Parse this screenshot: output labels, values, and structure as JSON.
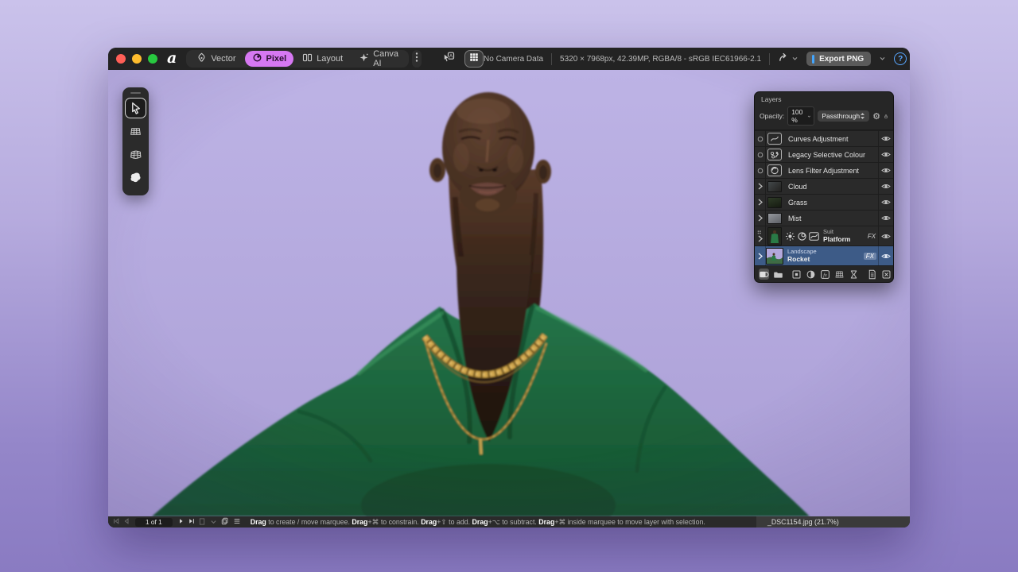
{
  "titlebar": {
    "personas": {
      "vector": "Vector",
      "pixel": "Pixel",
      "layout": "Layout",
      "canva_ai": "Canva AI"
    },
    "camera_status": "No Camera Data",
    "document_info": "5320 × 7968px, 42.39MP, RGBA/8 - sRGB IEC61966-2.1",
    "export_label": "Export PNG",
    "help_label": "?"
  },
  "layers": {
    "panel_title": "Layers",
    "opacity_label": "Opacity:",
    "opacity_value": "100 %",
    "blend_mode": "Passthrough",
    "rows": [
      {
        "name": "Curves Adjustment"
      },
      {
        "name": "Legacy Selective Colour"
      },
      {
        "name": "Lens Filter Adjustment"
      },
      {
        "name": "Cloud"
      },
      {
        "name": "Grass"
      },
      {
        "name": "Mist"
      },
      {
        "tag": "Suit",
        "name": "Platform",
        "fx": "FX"
      },
      {
        "tag": "Landscape",
        "name": "Rocket",
        "fx": "FX",
        "selected": true
      }
    ]
  },
  "statusbar": {
    "page_indicator": "1 of 1",
    "file_info": "_DSC1154.jpg (21.7%)",
    "hint_segments": [
      {
        "text": "Drag",
        "bold": true
      },
      {
        "text": " to create / move marquee. ",
        "bold": false
      },
      {
        "text": "Drag",
        "bold": true
      },
      {
        "text": "+⌘ to constrain. ",
        "bold": false
      },
      {
        "text": "Drag",
        "bold": true
      },
      {
        "text": "+⇧ to add. ",
        "bold": false
      },
      {
        "text": "Drag",
        "bold": true
      },
      {
        "text": "+⌥ to subtract. ",
        "bold": false
      },
      {
        "text": "Drag",
        "bold": true
      },
      {
        "text": "+⌘ inside marquee to move layer with selection.",
        "bold": false
      }
    ]
  },
  "icons": {
    "gear": "⚙"
  },
  "colors": {
    "pixel_pill": "#d678f2",
    "selection_blue": "#3d5b87",
    "export_accent": "#43a6ff",
    "help_blue": "#58a6ff",
    "canvas_bg": "#b5abdd",
    "suit_green": "#1f6b3c"
  }
}
